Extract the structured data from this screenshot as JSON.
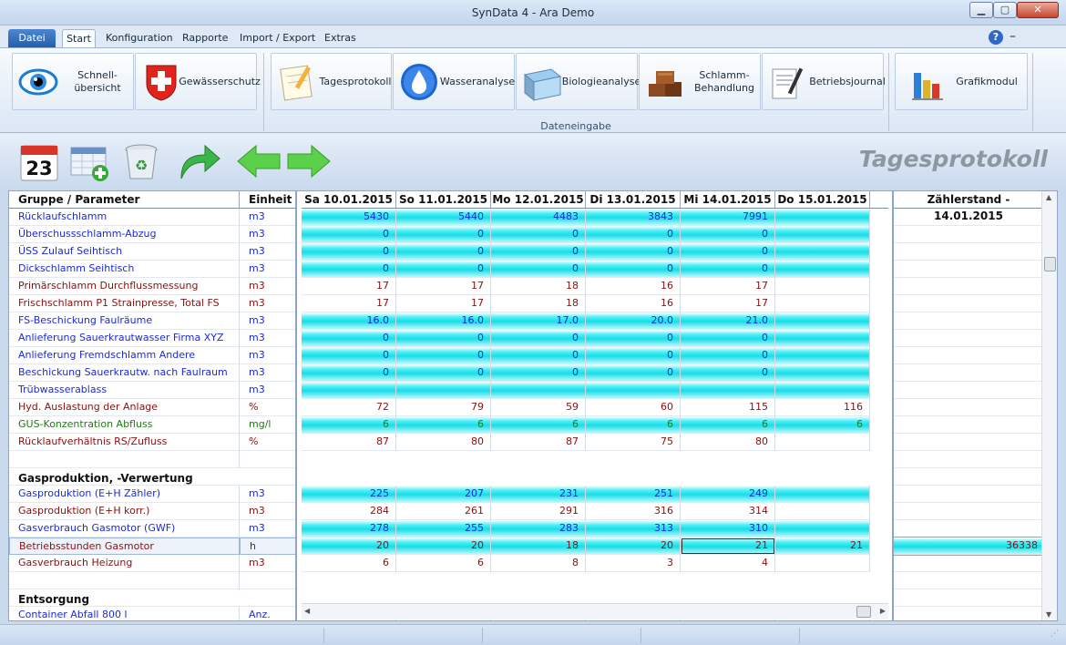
{
  "window": {
    "title": "SynData 4 - Ara Demo",
    "btn_min": "▁",
    "btn_max": "▢",
    "btn_close": "✕"
  },
  "menu": {
    "datei": "Datei",
    "tabs": [
      "Start",
      "Konfiguration",
      "Rapporte",
      "Import / Export",
      "Extras"
    ],
    "help": "?",
    "collapse": "–"
  },
  "ribbon": {
    "buttons": [
      {
        "label": "Schnell-\nübersicht",
        "icon": "eye-icon"
      },
      {
        "label": "Gewässerschutz",
        "icon": "swiss-cross-icon"
      },
      {
        "label": "Tagesprotokoll",
        "icon": "notepad-icon"
      },
      {
        "label": "Wasseranalyse",
        "icon": "water-drop-icon"
      },
      {
        "label": "Biologieanalyse",
        "icon": "basin-icon"
      },
      {
        "label": "Schlamm-\nBehandlung",
        "icon": "sludge-bricks-icon"
      },
      {
        "label": "Betriebsjournal",
        "icon": "journal-pen-icon"
      },
      {
        "label": "Grafikmodul",
        "icon": "bar-chart-icon"
      }
    ],
    "group_label": "Dateneingabe"
  },
  "toolbar": {
    "calendar_day": "23",
    "page_title": "Tagesprotokoll"
  },
  "colors": {
    "cyan": "#19dde7",
    "blue_text": "#1b2ad9",
    "red_text": "#8a0f0f",
    "green_text": "#1f7a18"
  },
  "grid": {
    "header": {
      "param": "Gruppe / Parameter",
      "unit": "Einheit"
    },
    "dates": [
      "Sa 10.01.2015",
      "So 11.01.2015",
      "Mo 12.01.2015",
      "Di 13.01.2015",
      "Mi 14.01.2015",
      "Do 15.01.2015"
    ],
    "counter_header": "Zählerstand - 14.01.2015",
    "rows": [
      {
        "name": "Rücklaufschlamm",
        "unit": "m3",
        "color": "blue",
        "cyan": true,
        "values": [
          "5430",
          "5440",
          "4483",
          "3843",
          "7991",
          ""
        ],
        "counter": ""
      },
      {
        "name": "Überschussschlamm-Abzug",
        "unit": "m3",
        "color": "blue",
        "cyan": true,
        "values": [
          "0",
          "0",
          "0",
          "0",
          "0",
          ""
        ],
        "counter": ""
      },
      {
        "name": "ÜSS Zulauf Seihtisch",
        "unit": "m3",
        "color": "blue",
        "cyan": true,
        "values": [
          "0",
          "0",
          "0",
          "0",
          "0",
          ""
        ],
        "counter": ""
      },
      {
        "name": "Dickschlamm Seihtisch",
        "unit": "m3",
        "color": "blue",
        "cyan": true,
        "values": [
          "0",
          "0",
          "0",
          "0",
          "0",
          ""
        ],
        "counter": ""
      },
      {
        "name": "Primärschlamm Durchflussmessung",
        "unit": "m3",
        "color": "red",
        "cyan": false,
        "values": [
          "17",
          "17",
          "18",
          "16",
          "17",
          ""
        ],
        "counter": ""
      },
      {
        "name": "Frischschlamm P1 Strainpresse, Total FS",
        "unit": "m3",
        "color": "red",
        "cyan": false,
        "values": [
          "17",
          "17",
          "18",
          "16",
          "17",
          ""
        ],
        "counter": ""
      },
      {
        "name": "FS-Beschickung Faulräume",
        "unit": "m3",
        "color": "blue",
        "cyan": true,
        "values": [
          "16.0",
          "16.0",
          "17.0",
          "20.0",
          "21.0",
          ""
        ],
        "counter": ""
      },
      {
        "name": "Anlieferung Sauerkrautwasser Firma XYZ",
        "unit": "m3",
        "color": "blue",
        "cyan": true,
        "values": [
          "0",
          "0",
          "0",
          "0",
          "0",
          ""
        ],
        "counter": ""
      },
      {
        "name": "Anlieferung Fremdschlamm Andere",
        "unit": "m3",
        "color": "blue",
        "cyan": true,
        "values": [
          "0",
          "0",
          "0",
          "0",
          "0",
          ""
        ],
        "counter": ""
      },
      {
        "name": "Beschickung Sauerkrautw. nach Faulraum",
        "unit": "m3",
        "color": "blue",
        "cyan": true,
        "values": [
          "0",
          "0",
          "0",
          "0",
          "0",
          ""
        ],
        "counter": ""
      },
      {
        "name": "Trübwasserablass",
        "unit": "m3",
        "color": "blue",
        "cyan": true,
        "values": [
          "",
          "",
          "",
          "",
          "",
          ""
        ],
        "counter": ""
      },
      {
        "name": "Hyd. Auslastung der Anlage",
        "unit": "%",
        "color": "red",
        "cyan": false,
        "values": [
          "72",
          "79",
          "59",
          "60",
          "115",
          "116"
        ],
        "counter": ""
      },
      {
        "name": "GUS-Konzentration Abfluss",
        "unit": "mg/l",
        "color": "green",
        "cyan": true,
        "values": [
          "6",
          "6",
          "6",
          "6",
          "6",
          "6"
        ],
        "counter": ""
      },
      {
        "name": "Rücklaufverhältnis RS/Zufluss",
        "unit": "%",
        "color": "red",
        "cyan": false,
        "values": [
          "87",
          "80",
          "87",
          "75",
          "80",
          ""
        ],
        "counter": ""
      },
      {
        "name": "",
        "unit": "",
        "color": "red",
        "cyan": false,
        "values": [
          "",
          "",
          "",
          "",
          "",
          ""
        ],
        "counter": ""
      },
      {
        "name": "Gasproduktion, -Verwertung",
        "unit": "",
        "color": "grp",
        "cyan": false,
        "values": [
          "",
          "",
          "",
          "",
          "",
          ""
        ],
        "counter": ""
      },
      {
        "name": "Gasproduktion (E+H Zähler)",
        "unit": "m3",
        "color": "blue",
        "cyan": true,
        "values": [
          "225",
          "207",
          "231",
          "251",
          "249",
          ""
        ],
        "counter": ""
      },
      {
        "name": "Gasproduktion (E+H korr.)",
        "unit": "m3",
        "color": "red",
        "cyan": false,
        "values": [
          "284",
          "261",
          "291",
          "316",
          "314",
          ""
        ],
        "counter": ""
      },
      {
        "name": "Gasverbrauch Gasmotor (GWF)",
        "unit": "m3",
        "color": "blue",
        "cyan": true,
        "values": [
          "278",
          "255",
          "283",
          "313",
          "310",
          ""
        ],
        "counter": ""
      },
      {
        "name": "Betriebsstunden Gasmotor",
        "unit": "h",
        "color": "red",
        "cyan": true,
        "selected": true,
        "values": [
          "20",
          "20",
          "18",
          "20",
          "21",
          "21"
        ],
        "counter": "36338"
      },
      {
        "name": "Gasverbrauch Heizung",
        "unit": "m3",
        "color": "red",
        "cyan": false,
        "values": [
          "6",
          "6",
          "8",
          "3",
          "4",
          ""
        ],
        "counter": ""
      },
      {
        "name": "",
        "unit": "",
        "color": "red",
        "cyan": false,
        "values": [
          "",
          "",
          "",
          "",
          "",
          ""
        ],
        "counter": ""
      },
      {
        "name": "Entsorgung",
        "unit": "",
        "color": "grp",
        "cyan": false,
        "values": [
          "",
          "",
          "",
          "",
          "",
          ""
        ],
        "counter": ""
      },
      {
        "name": "Container Abfall 800 l",
        "unit": "Anz.",
        "color": "blue",
        "cyan": false,
        "values": [
          "",
          "",
          "",
          "",
          "",
          ""
        ],
        "counter": ""
      }
    ]
  }
}
